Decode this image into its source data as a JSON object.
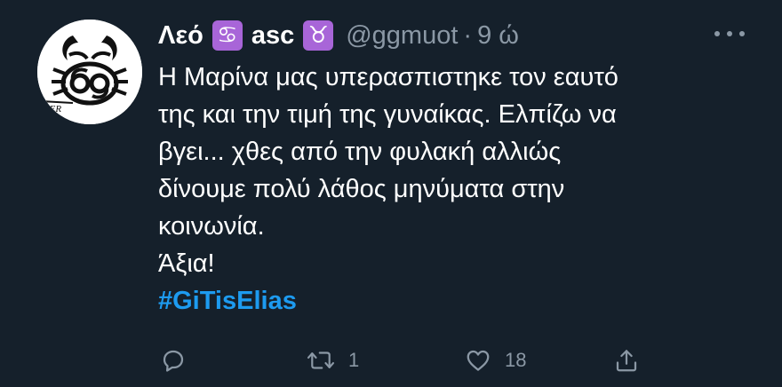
{
  "tweet": {
    "display_name": "Λεό",
    "name_sign_icon": "♋",
    "secondary_name": "asc",
    "secondary_sign_icon": "♉",
    "handle": "@ggmuot",
    "separator": "·",
    "time": "9 ώ",
    "text_lines": [
      "Η Μαρίνα μας υπερασπιστηκε τον εαυτό",
      "της και την τιμή της γυναίκας. Ελπίζω να",
      "βγει... χθες από την φυλακή αλλιώς",
      "δίνουμε πολύ λάθος μηνύματα στην",
      "κοινωνία.",
      "Άξια!"
    ],
    "hashtag": "#GiTisElias",
    "avatar_text": "rCER"
  },
  "actions": {
    "reply_count": "",
    "retweet_count": "1",
    "like_count": "18"
  },
  "colors": {
    "background": "#15202b",
    "text": "#ffffff",
    "muted": "#8b98a5",
    "link": "#1d9bf0",
    "zodiac_badge": "#a865d8"
  }
}
